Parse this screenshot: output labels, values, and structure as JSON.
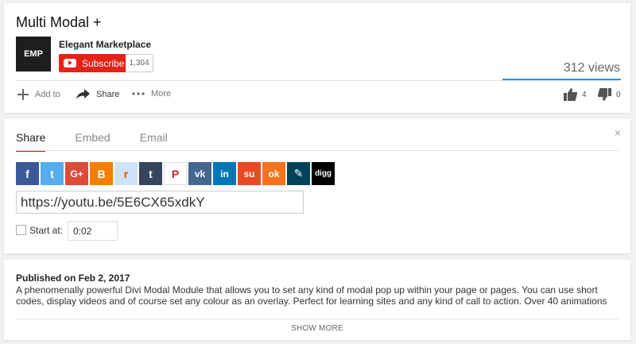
{
  "video": {
    "title": "Multi Modal +",
    "views": "312 views"
  },
  "channel": {
    "avatar_text": "EMP",
    "name": "Elegant Marketplace",
    "subscribe_label": "Subscribe",
    "subscriber_count": "1,304"
  },
  "actions": {
    "add_to": "Add to",
    "share": "Share",
    "more": "More",
    "likes": "4",
    "dislikes": "0"
  },
  "share_panel": {
    "tabs": [
      "Share",
      "Embed",
      "Email"
    ],
    "active_tab": "Share",
    "close": "×",
    "social_icons": [
      {
        "name": "facebook-icon",
        "glyph": "f",
        "color": "#3b5998"
      },
      {
        "name": "twitter-icon",
        "glyph": "t",
        "color": "#55acee"
      },
      {
        "name": "google-plus-icon",
        "glyph": "G+",
        "color": "#dd4b39"
      },
      {
        "name": "blogger-icon",
        "glyph": "B",
        "color": "#f57d00"
      },
      {
        "name": "reddit-icon",
        "glyph": "r",
        "color": "#cee3f8"
      },
      {
        "name": "tumblr-icon",
        "glyph": "t",
        "color": "#35465c"
      },
      {
        "name": "pinterest-icon",
        "glyph": "P",
        "color": "#ffffff"
      },
      {
        "name": "vk-icon",
        "glyph": "vk",
        "color": "#45668e"
      },
      {
        "name": "linkedin-icon",
        "glyph": "in",
        "color": "#0077b5"
      },
      {
        "name": "stumbleupon-icon",
        "glyph": "su",
        "color": "#eb4924"
      },
      {
        "name": "odnoklassniki-icon",
        "glyph": "ok",
        "color": "#f4731c"
      },
      {
        "name": "livejournal-icon",
        "glyph": "✎",
        "color": "#004359"
      },
      {
        "name": "digg-icon",
        "glyph": "digg",
        "color": "#000000"
      }
    ],
    "share_url": "https://youtu.be/5E6CX65xdkY",
    "start_at_label": "Start at:",
    "start_time": "0:02"
  },
  "description": {
    "published": "Published on Feb 2, 2017",
    "text": "A phenomenally powerful Divi Modal Module that allows you to set any kind of modal pop up within your page or pages. You can use short codes, display videos and of course set any colour as an overlay. Perfect for learning sites and any kind of call to action. Over 40 animations",
    "show_more": "SHOW MORE"
  }
}
